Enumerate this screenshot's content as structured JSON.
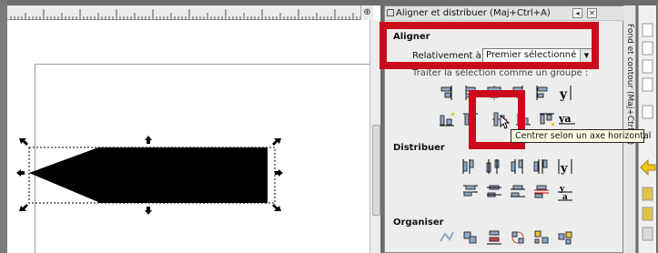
{
  "canvas": {
    "ruler_corner_icon": "zoom-icon",
    "shape_fill_color": "#000000",
    "selection_handle_color": "#000000"
  },
  "panel": {
    "title": "Aligner et distribuer (Maj+Ctrl+A)",
    "side_tab_label": "Fond et contour (Maj+Ctrl+F)",
    "align_section": {
      "heading": "Aligner",
      "relative_label": "Relativement à :",
      "relative_value": "Premier sélectionné",
      "treat_as_group": "Traiter la sélection comme un groupe :"
    },
    "distribute_section": {
      "heading": "Distribuer"
    },
    "arrange_section": {
      "heading": "Organiser"
    }
  },
  "tooltip": {
    "text": "Centrer selon un axe horizontal"
  },
  "highlights": {
    "color": "#cc0a1e"
  }
}
